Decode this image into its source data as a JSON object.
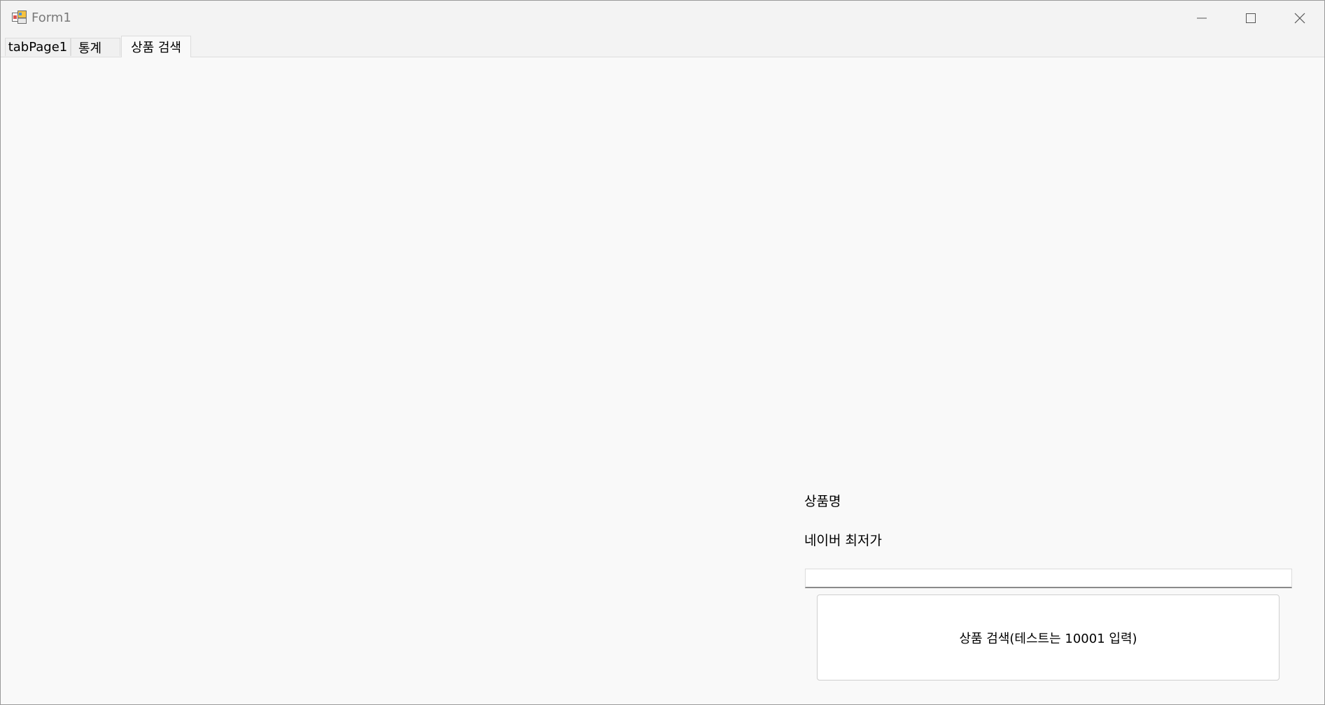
{
  "window": {
    "title": "Form1",
    "icon": "winforms-app-icon",
    "controls": [
      "minimize-icon",
      "maximize-icon",
      "close-icon"
    ]
  },
  "tabs": [
    {
      "label": "tabPage1",
      "selected": false
    },
    {
      "label": "통계",
      "selected": false
    },
    {
      "label": "상품 검색",
      "selected": true
    }
  ],
  "main": {
    "product_name_label": "상품명",
    "naver_lowest_price_label": "네이버 최저가",
    "search_input_value": "",
    "search_button_label": "상품 검색(테스트는 10001 입력)"
  }
}
